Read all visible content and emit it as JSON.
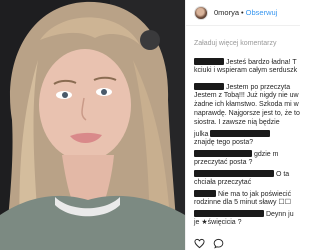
{
  "post": {
    "username": "0morya",
    "separator": "•",
    "follow_label": "Obserwuj"
  },
  "comments_panel": {
    "load_more": "Załaduj więcej komentarzy",
    "comments": [
      {
        "text": "Jesteś bardzo ładna! T"
      },
      {
        "text": "kciuki i wspieram całym serduszk"
      },
      {
        "text": "Jestem po przeczyta"
      },
      {
        "text": "Jestem z Tobą!!! Już nigdy nie uw"
      },
      {
        "text": "żadne ich kłamstwo. Szkoda mi w"
      },
      {
        "text": "naprawdę. Najgorsze jest to, że to"
      },
      {
        "text": "siostra. I zawsze nią będzie"
      },
      {
        "text": "julka"
      },
      {
        "text": "znajdę tego posta?"
      },
      {
        "text": "gdzie m"
      },
      {
        "text": "przeczytać posta ?"
      },
      {
        "text": "O ta"
      },
      {
        "text": "chciała przeczytać"
      },
      {
        "text": "Nie ma to jak poświecić"
      },
      {
        "text": "rodzinne dla 5 minut sławy ☐☐"
      },
      {
        "text": "Deynn ju"
      },
      {
        "text": "je ★święcicia ?"
      }
    ]
  },
  "icons": {
    "like": "heart-icon",
    "comment": "comment-icon"
  }
}
